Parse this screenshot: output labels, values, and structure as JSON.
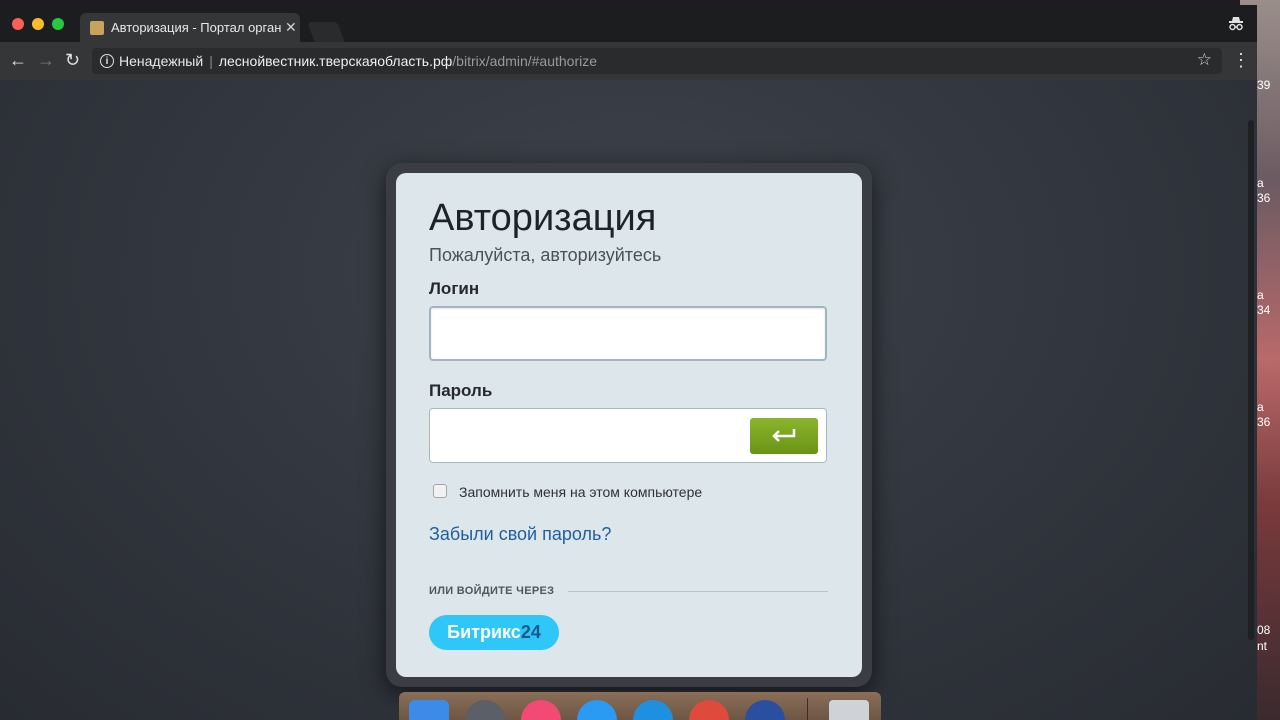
{
  "browser": {
    "tab_title": "Авторизация - Портал органи",
    "tab_close": "✕",
    "security_label": "Ненадежный",
    "url_separator": "|",
    "url_host": "леснойвестник.тверскаяобласть.рф",
    "url_path": "/bitrix/admin/#authorize",
    "incognito_icon": "incognito-icon",
    "back_icon": "←",
    "forward_icon": "→",
    "reload_icon": "↻",
    "star_icon": "☆",
    "menu_icon": "⋮"
  },
  "desktop": {
    "side_fragments": [
      "39",
      "а",
      "36",
      "а",
      "34",
      "а",
      "36",
      "08",
      "nt"
    ]
  },
  "login": {
    "title": "Авторизация",
    "subtitle": "Пожалуйста, авторизуйтесь",
    "login_label": "Логин",
    "login_value": "",
    "password_label": "Пароль",
    "password_value": "",
    "submit_icon": "⮠",
    "remember_label": "Запомнить меня на этом компьютере",
    "forgot_link": "Забыли свой пароль?",
    "alt_login_label": "ИЛИ ВОЙДИТЕ ЧЕРЕЗ",
    "bitrix_label": "Битрикс",
    "bitrix_number": "24"
  },
  "colors": {
    "accent_green": "#7aa51f",
    "bitrix_blue": "#2fc7f7",
    "link_blue": "#1f5f9e",
    "card_bg": "#dde6ea"
  }
}
